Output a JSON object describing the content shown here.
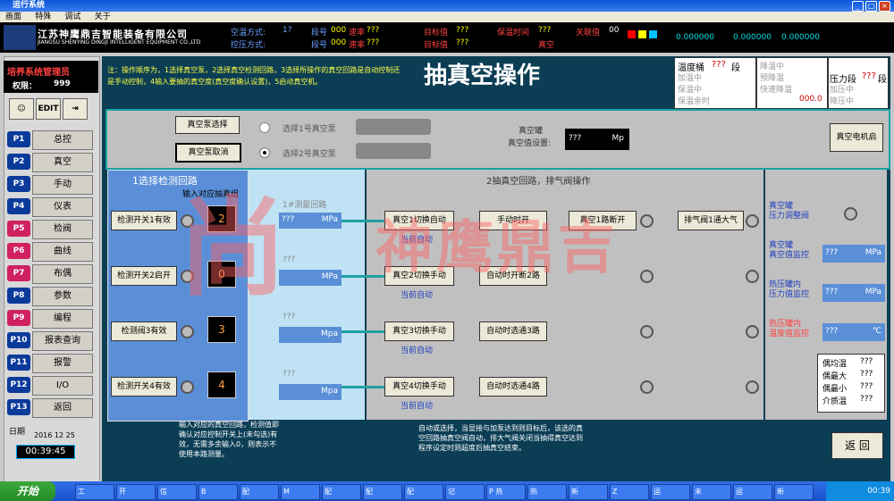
{
  "window": {
    "title": "运行系统"
  },
  "menu": [
    "画面",
    "特殊",
    "调试",
    "关于"
  ],
  "header": {
    "company_cn": "江苏神鹰鼎吉智能装备有限公司",
    "company_en": "JIANGSU SHENYING DINGJI INTELLIGENT EQUIPMENT CO.,LTD",
    "row1": [
      {
        "label": "空温方式:",
        "value": "1?"
      },
      {
        "label": "段号",
        "value": "000"
      },
      {
        "label": "速率",
        "value": "???"
      },
      {
        "label": "目标值",
        "value": "???"
      },
      {
        "label": "保温时间",
        "value": "???"
      },
      {
        "label": "关联值",
        "value": "00"
      }
    ],
    "row2": [
      {
        "label": "控压方式:",
        "value": ""
      },
      {
        "label": "段号",
        "value": "000"
      },
      {
        "label": "速率",
        "value": "???"
      },
      {
        "label": "目标值",
        "value": "???"
      },
      {
        "label": "",
        "value": "真空"
      }
    ],
    "readouts": [
      "0.000000",
      "0.000000",
      "0.000000"
    ]
  },
  "left": {
    "system_name": "培养系统管理员",
    "permission_label": "权限：",
    "permission_value": "999",
    "edit_label": "EDIT",
    "nav": [
      {
        "code": "P1",
        "label": "总控"
      },
      {
        "code": "P2",
        "label": "真空"
      },
      {
        "code": "P3",
        "label": "手动"
      },
      {
        "code": "P4",
        "label": "仪表"
      },
      {
        "code": "P5",
        "label": "检阀"
      },
      {
        "code": "P6",
        "label": "曲线"
      },
      {
        "code": "P7",
        "label": "布偶"
      },
      {
        "code": "P8",
        "label": "参数"
      },
      {
        "code": "P9",
        "label": "编程"
      },
      {
        "code": "P10",
        "label": "报表查询"
      },
      {
        "code": "P11",
        "label": "报警"
      },
      {
        "code": "P12",
        "label": "I/O"
      },
      {
        "code": "P13",
        "label": "返回"
      }
    ],
    "date_label": "日期",
    "date_value": "2016 12 25",
    "time_value": "00:39:45"
  },
  "main": {
    "note": "注：操作顺序为，1选择真空泵，2选择真空检测回路，3选择所操作的真空回路是自动控制还是手动控制，4输入要抽的真空度(真空度确认设置)，5启动真空机。",
    "title": "抽真空操作",
    "status_box1": {
      "title": "温度桶",
      "value": "???",
      "suffix": "段",
      "lines": [
        "加温中",
        "保温中",
        "保温余时"
      ]
    },
    "status_box2": {
      "lines": [
        "降温中",
        "预降温",
        "快速降温"
      ],
      "value": "000.0"
    },
    "status_box3": {
      "title": "压力段",
      "value": "???",
      "suffix": "段",
      "lines": [
        "加压中",
        "降压中"
      ]
    },
    "pump": {
      "select_button": "真空泵选择",
      "cancel_button": "真空泵取消",
      "option1": "选择1号真空泵",
      "option2": "选择2号真空泵",
      "tank_label": "真空罐",
      "setting_label": "真空值设置:",
      "setting_value": "???",
      "setting_unit": "Mp",
      "start_button": "真空电机启"
    },
    "detect": {
      "title": "1选择检测回路",
      "subtitle": "输入对应抽真组",
      "items": [
        {
          "button": "检测开关1有效",
          "value": "2"
        },
        {
          "button": "检测开关2启开",
          "value": "0"
        },
        {
          "button": "检测阀3有效",
          "value": "3"
        },
        {
          "button": "检测开关4有效",
          "value": "4"
        }
      ],
      "footnote": "输入对应的真空回路，检测值即确认对应控制开关上(未勾选)有效，无需多余输入0，则表示不使用本路测量。"
    },
    "measure": {
      "items": [
        {
          "label": "1#测量回路",
          "value": "???",
          "unit": "MPa"
        },
        {
          "label": "???",
          "value": "",
          "unit": "MPa"
        },
        {
          "label": "???",
          "value": "",
          "unit": "Mpa"
        },
        {
          "label": "???",
          "value": "",
          "unit": "Mpa"
        }
      ]
    },
    "circuit": {
      "title": "2抽真空回路，排气阀操作",
      "rows": [
        {
          "manual": "真空1切换自动",
          "mode": "当前自动",
          "auto": "手动时开",
          "mid": "真空1路断开",
          "right": "排气阀1通大气"
        },
        {
          "manual": "真空2切换手动",
          "mode": "当前自动",
          "auto": "自动时开断2路"
        },
        {
          "manual": "真空3切换手动",
          "mode": "当前自动",
          "auto": "自动时选通3路"
        },
        {
          "manual": "真空4切换手动",
          "mode": "当前自动",
          "auto": "自动时选通4路"
        }
      ],
      "footnote": "自动或选择，当显接与加泵达到则目标后，该选的真空回路抽真空阀自动，排大气阀关闭当抽得真空达到程序设定时则超度后抽真空结束。"
    },
    "right": {
      "items": [
        {
          "label": "真空罐\n压力调整阀"
        },
        {
          "label": "真空罐\n真空值监控",
          "value": "???",
          "unit": "MPa"
        },
        {
          "label": "热压罐内\n压力值监控",
          "value": "???",
          "unit": "MPa"
        },
        {
          "label": "热压罐内\n温度值监控",
          "value": "???",
          "unit": "℃"
        }
      ],
      "stats": [
        {
          "label": "偶均温",
          "value": "???"
        },
        {
          "label": "偶最大",
          "value": "???"
        },
        {
          "label": "偶最小",
          "value": "???"
        },
        {
          "label": "介质温",
          "value": "???"
        }
      ],
      "return_button": "返 回"
    }
  },
  "watermark": "神鹰鼎吉",
  "taskbar": {
    "start": "开始",
    "items": [
      "工",
      "开",
      "信",
      "B",
      "配",
      "M",
      "配",
      "配",
      "配",
      "记",
      "P 热",
      "热",
      "新",
      "Z",
      "运",
      "未",
      "运",
      "新"
    ],
    "clock": "00:39"
  },
  "colors": {
    "panel_bg": "#0b3e55",
    "accent": "#16a3a3",
    "mid_panel": "#c0c0c0",
    "detect_bg": "#5a8fd8"
  }
}
